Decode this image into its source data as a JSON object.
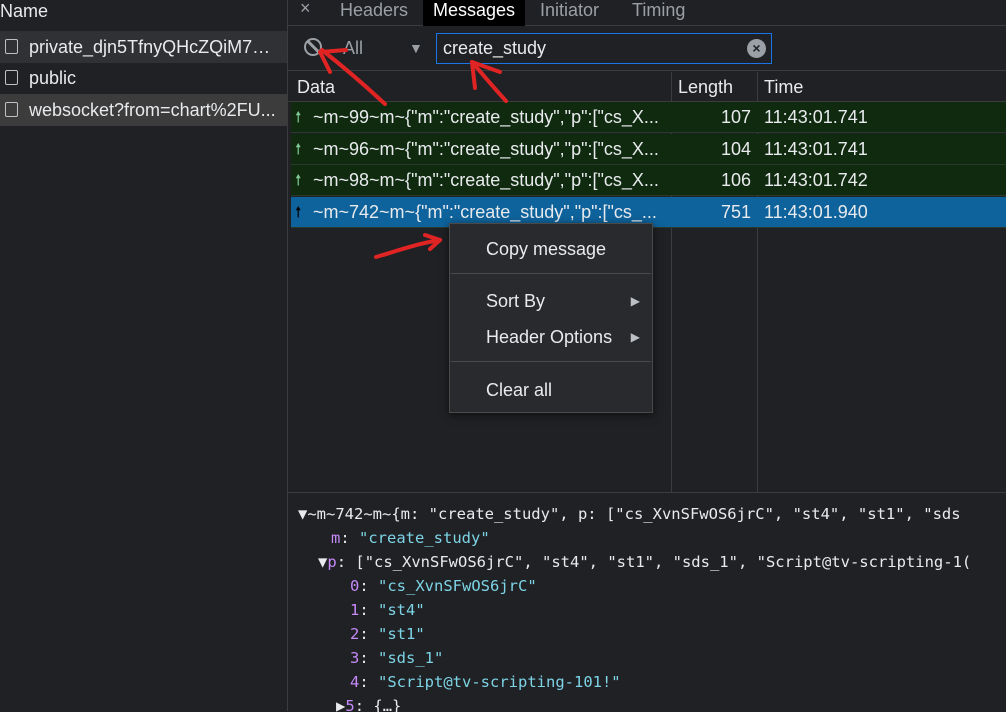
{
  "left_panel": {
    "header": "Name",
    "requests": [
      {
        "name": "private_djn5TfnyQHcZQiM7M..."
      },
      {
        "name": "public"
      },
      {
        "name": "websocket?from=chart%2FU..."
      }
    ]
  },
  "tabs": {
    "close": "×",
    "items": [
      "Headers",
      "Messages",
      "Initiator",
      "Timing"
    ],
    "active": "Messages"
  },
  "filter": {
    "type_value": "All",
    "search_value": "create_study"
  },
  "grid": {
    "headers": {
      "data": "Data",
      "length": "Length",
      "time": "Time"
    },
    "rows": [
      {
        "data": "~m~99~m~{\"m\":\"create_study\",\"p\":[\"cs_X...",
        "length": "107",
        "time": "11:43:01.741"
      },
      {
        "data": "~m~96~m~{\"m\":\"create_study\",\"p\":[\"cs_X...",
        "length": "104",
        "time": "11:43:01.741"
      },
      {
        "data": "~m~98~m~{\"m\":\"create_study\",\"p\":[\"cs_X...",
        "length": "106",
        "time": "11:43:01.742"
      },
      {
        "data": "~m~742~m~{\"m\":\"create_study\",\"p\":[\"cs_...",
        "length": "751",
        "time": "11:43:01.940"
      }
    ]
  },
  "context_menu": {
    "items": [
      "Copy message",
      "Sort By",
      "Header Options",
      "Clear all"
    ]
  },
  "detail": {
    "root": "~m~742~m~{m: \"create_study\", p: [\"cs_XvnSFwOS6jrC\", \"st4\", \"st1\", \"sds",
    "m_key": "m",
    "m_value": "\"create_study\"",
    "p_key": "p",
    "p_value": "[\"cs_XvnSFwOS6jrC\", \"st4\", \"st1\", \"sds_1\", \"Script@tv-scripting-1(",
    "items": [
      {
        "idx": "0",
        "val": "\"cs_XvnSFwOS6jrC\""
      },
      {
        "idx": "1",
        "val": "\"st4\""
      },
      {
        "idx": "2",
        "val": "\"st1\""
      },
      {
        "idx": "3",
        "val": "\"sds_1\""
      },
      {
        "idx": "4",
        "val": "\"Script@tv-scripting-101!\""
      },
      {
        "idx": "5",
        "val": "{…}"
      }
    ]
  },
  "colors": {
    "annotation": "#e02424",
    "selected_row": "#0e639c",
    "sent_row": "#0f2a0f"
  }
}
